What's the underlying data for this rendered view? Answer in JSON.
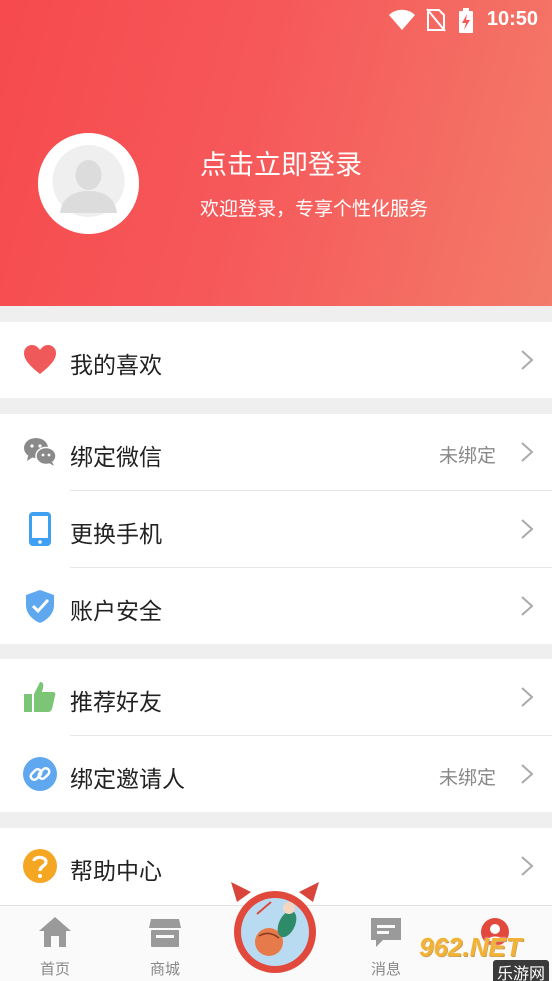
{
  "status": {
    "time": "10:50"
  },
  "profile": {
    "title": "点击立即登录",
    "subtitle": "欢迎登录，专享个性化服务"
  },
  "menu": {
    "favorites": {
      "label": "我的喜欢"
    },
    "wechat": {
      "label": "绑定微信",
      "value": "未绑定"
    },
    "phone": {
      "label": "更换手机"
    },
    "security": {
      "label": "账户安全"
    },
    "recommend": {
      "label": "推荐好友"
    },
    "inviter": {
      "label": "绑定邀请人",
      "value": "未绑定"
    },
    "help": {
      "label": "帮助中心"
    }
  },
  "tabbar": {
    "home": "首页",
    "mall": "商城",
    "messages": "消息"
  },
  "watermark": {
    "brand": "962.NET",
    "site": "乐游网"
  },
  "colors": {
    "accent": "#f64a4d",
    "blue_icon": "#3f9ff0",
    "green_icon": "#7cc576",
    "help_icon": "#f5a623"
  }
}
